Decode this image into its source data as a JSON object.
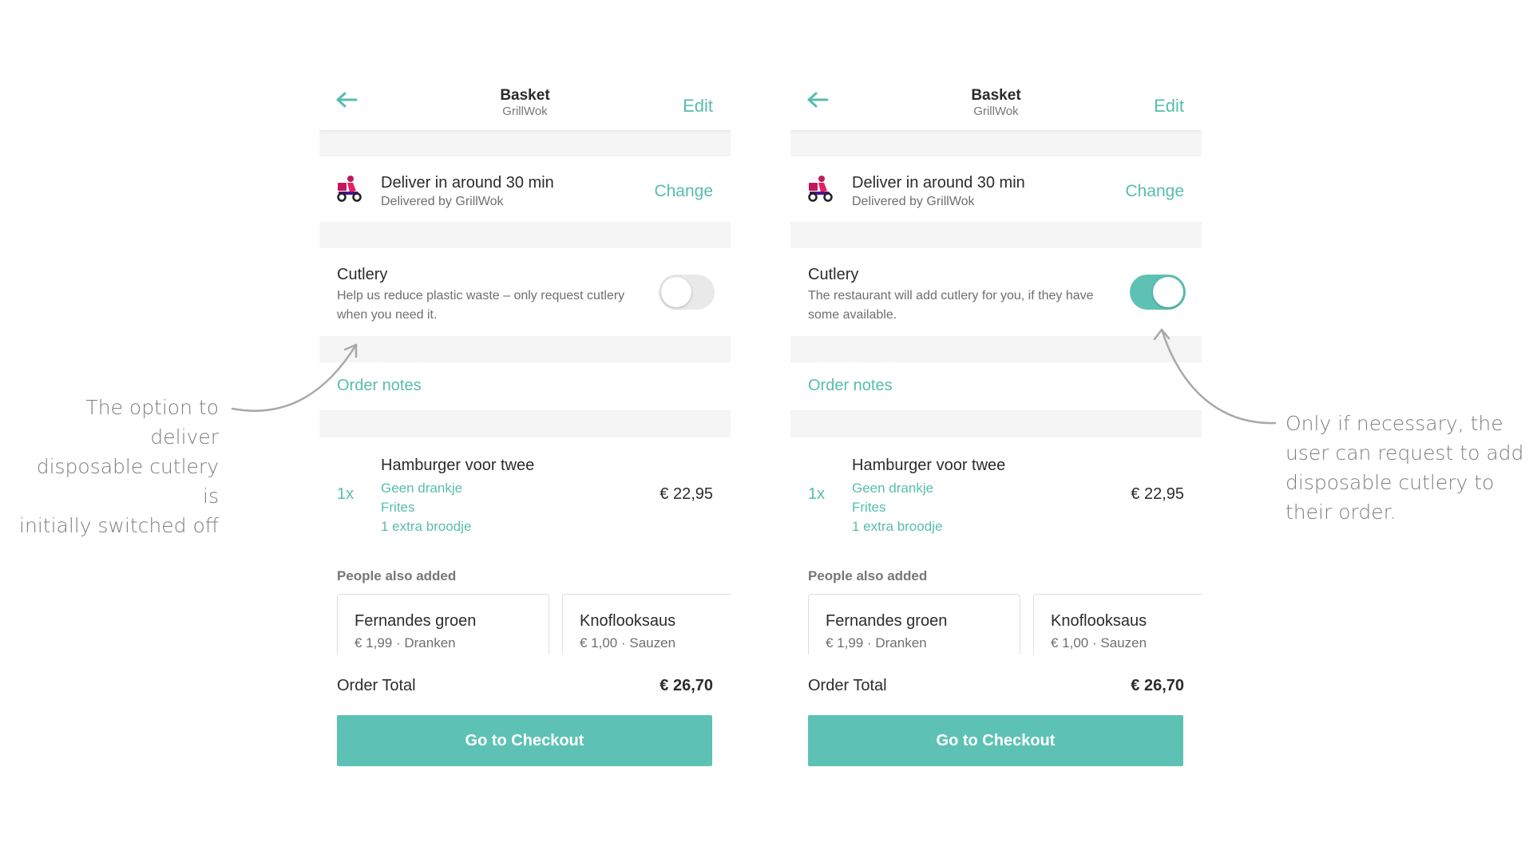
{
  "colors": {
    "accent": "#57bdae",
    "toggle_on": "#5dc2b4",
    "toggle_off": "#e9e9e9",
    "checkout_bg": "#5dc2b4"
  },
  "screens": [
    {
      "header": {
        "back_icon": "arrow-left-icon",
        "title": "Basket",
        "subtitle": "GrillWok",
        "edit_label": "Edit"
      },
      "delivery": {
        "icon": "scooter-icon",
        "title": "Deliver in around 30 min",
        "subtitle": "Delivered by GrillWok",
        "change_label": "Change"
      },
      "cutlery": {
        "title": "Cutlery",
        "description": "Help us reduce plastic waste – only request cutlery when you need it.",
        "toggle_on": false
      },
      "order_notes_label": "Order notes",
      "item": {
        "quantity": "1x",
        "name": "Hamburger voor twee",
        "options": [
          "Geen drankje",
          "Frites",
          "1 extra broodje"
        ],
        "price": "€ 22,95"
      },
      "people_also_added": {
        "title": "People also added",
        "cards": [
          {
            "name": "Fernandes groen",
            "meta": "€ 1,99 · Dranken"
          },
          {
            "name": "Knoflooksaus",
            "meta": "€ 1,00 · Sauzen"
          }
        ]
      },
      "total": {
        "label": "Order Total",
        "value": "€ 26,70"
      },
      "checkout_label": "Go to Checkout"
    },
    {
      "header": {
        "back_icon": "arrow-left-icon",
        "title": "Basket",
        "subtitle": "GrillWok",
        "edit_label": "Edit"
      },
      "delivery": {
        "icon": "scooter-icon",
        "title": "Deliver in around 30 min",
        "subtitle": "Delivered by GrillWok",
        "change_label": "Change"
      },
      "cutlery": {
        "title": "Cutlery",
        "description": "The restaurant will add cutlery for you, if they have some available.",
        "toggle_on": true
      },
      "order_notes_label": "Order notes",
      "item": {
        "quantity": "1x",
        "name": "Hamburger voor twee",
        "options": [
          "Geen drankje",
          "Frites",
          "1 extra broodje"
        ],
        "price": "€ 22,95"
      },
      "people_also_added": {
        "title": "People also added",
        "cards": [
          {
            "name": "Fernandes groen",
            "meta": "€ 1,99 · Dranken"
          },
          {
            "name": "Knoflooksaus",
            "meta": "€ 1,00 · Sauzen"
          }
        ]
      },
      "total": {
        "label": "Order Total",
        "value": "€ 26,70"
      },
      "checkout_label": "Go to Checkout"
    }
  ],
  "annotations": {
    "left": [
      "The option to deliver",
      "disposable cutlery is",
      "initially switched off"
    ],
    "right": [
      "Only if necessary, the",
      "user can request to add",
      "disposable cutlery to",
      "their order."
    ]
  }
}
